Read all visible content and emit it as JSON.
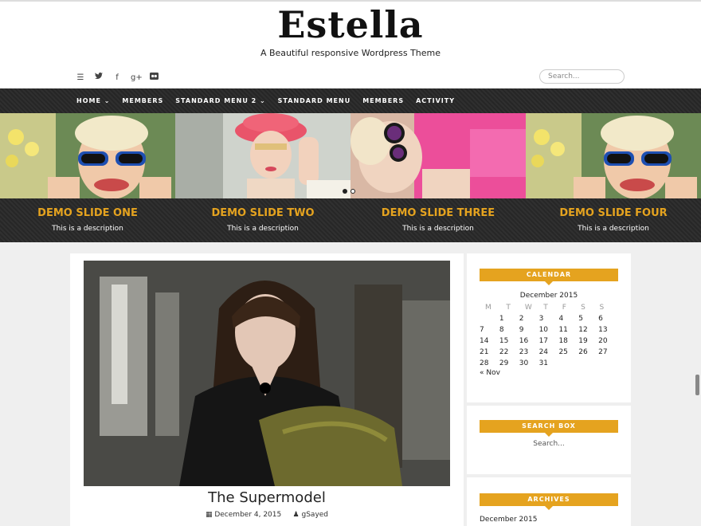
{
  "site": {
    "title": "Estella",
    "tagline": "A Beautiful responsive Wordpress Theme",
    "search_placeholder": "Search..."
  },
  "social_icons": [
    {
      "icon": "menu-icon",
      "glyph": "☰"
    },
    {
      "icon": "twitter-icon",
      "glyph": "🐦"
    },
    {
      "icon": "facebook-icon",
      "glyph": "f"
    },
    {
      "icon": "google-plus-icon",
      "glyph": "g+"
    },
    {
      "icon": "flickr-icon",
      "glyph": "●●"
    }
  ],
  "nav": {
    "items": [
      {
        "label": "HOME",
        "dropdown": true
      },
      {
        "label": "MEMBERS",
        "dropdown": false
      },
      {
        "label": "STANDARD MENU 2",
        "dropdown": true
      },
      {
        "label": "STANDARD MENU",
        "dropdown": false
      },
      {
        "label": "MEMBERS",
        "dropdown": false
      },
      {
        "label": "ACTIVITY",
        "dropdown": false
      }
    ]
  },
  "slider": {
    "slides": [
      {
        "title": "DEMO SLIDE ONE",
        "description": "This is a description"
      },
      {
        "title": "DEMO SLIDE TWO",
        "description": "This is a description"
      },
      {
        "title": "DEMO SLIDE THREE",
        "description": "This is a description"
      },
      {
        "title": "DEMO SLIDE FOUR",
        "description": "This is a description"
      }
    ]
  },
  "post": {
    "title": "The Supermodel",
    "date": "December 4, 2015",
    "author": "gSayed",
    "date_icon": "calendar-icon",
    "author_icon": "user-icon"
  },
  "sidebar": {
    "calendar": {
      "heading": "CALENDAR",
      "caption": "December 2015",
      "days": [
        "M",
        "T",
        "W",
        "T",
        "F",
        "S",
        "S"
      ],
      "weeks": [
        [
          "",
          "1",
          "2",
          "3",
          "4",
          "5",
          "6"
        ],
        [
          "7",
          "8",
          "9",
          "10",
          "11",
          "12",
          "13"
        ],
        [
          "14",
          "15",
          "16",
          "17",
          "18",
          "19",
          "20"
        ],
        [
          "21",
          "22",
          "23",
          "24",
          "25",
          "26",
          "27"
        ],
        [
          "28",
          "29",
          "30",
          "31",
          "",
          "",
          ""
        ]
      ],
      "prev": "« Nov"
    },
    "search": {
      "heading": "SEARCH BOX",
      "placeholder": "Search..."
    },
    "archives": {
      "heading": "ARCHIVES",
      "items": [
        "December 2015"
      ]
    }
  },
  "colors": {
    "accent": "#e5a31f",
    "nav_bg": "#2a2a2a"
  }
}
